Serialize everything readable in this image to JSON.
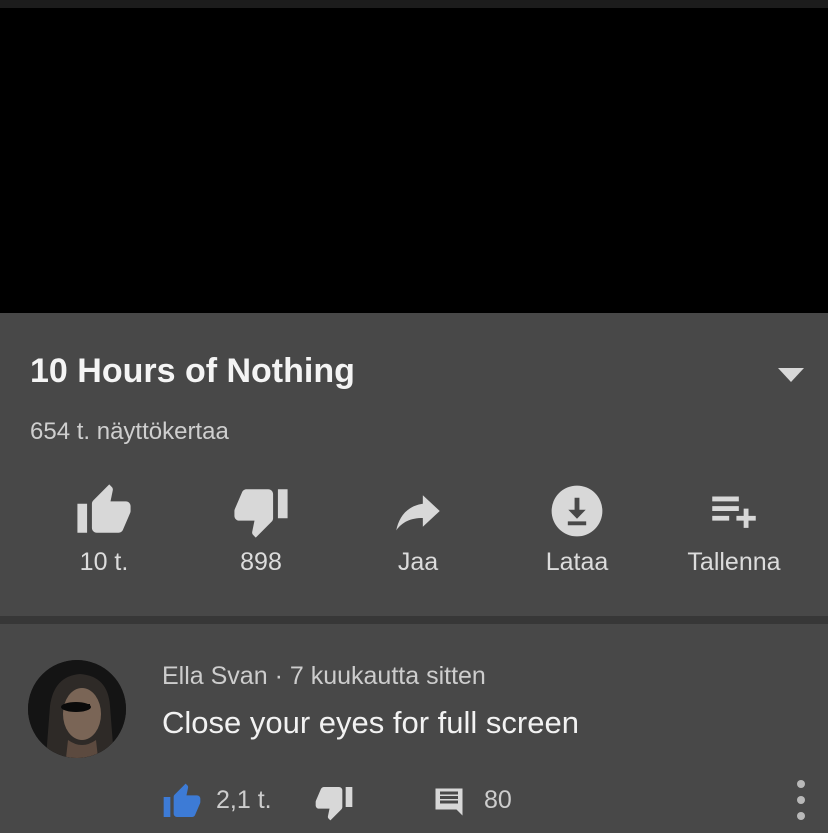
{
  "video": {
    "title": "10 Hours of Nothing",
    "views": "654 t. näyttökertaa"
  },
  "actions": [
    {
      "icon": "thumbs-up-icon",
      "label": "10 t."
    },
    {
      "icon": "thumbs-down-icon",
      "label": "898"
    },
    {
      "icon": "share-icon",
      "label": "Jaa"
    },
    {
      "icon": "download-icon",
      "label": "Lataa"
    },
    {
      "icon": "add-to-playlist-icon",
      "label": "Tallenna"
    }
  ],
  "comment": {
    "author": "Ella Svan",
    "separator": "·",
    "time": "7 kuukautta sitten",
    "text": "Close your eyes for full screen",
    "likes": "2,1 t.",
    "replies": "80"
  },
  "colors": {
    "panel_bg": "#484848",
    "video_bg": "#000000",
    "icon": "#d8d8d8",
    "like_active": "#3d7bd6"
  }
}
